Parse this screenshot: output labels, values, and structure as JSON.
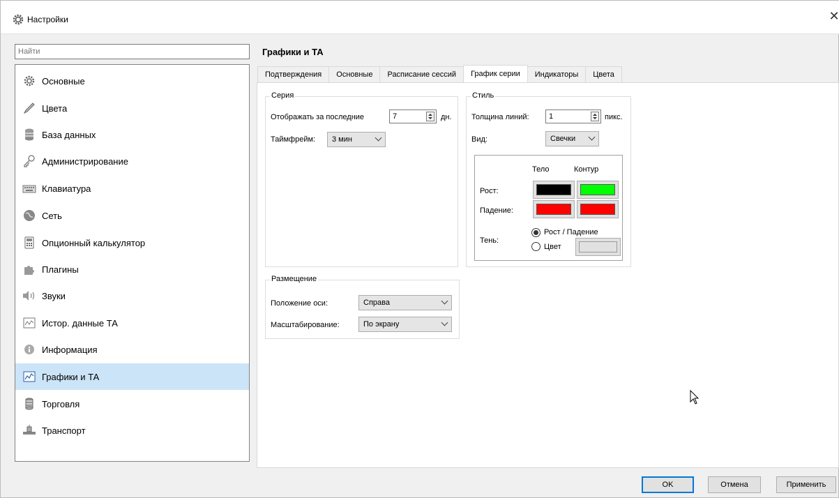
{
  "window": {
    "title": "Настройки",
    "title_icon": "gear-icon",
    "close_symbol": "✕"
  },
  "search": {
    "placeholder": "Найти"
  },
  "sidebar": {
    "items": [
      {
        "label": "Основные",
        "icon": "gear-icon"
      },
      {
        "label": "Цвета",
        "icon": "brush-icon"
      },
      {
        "label": "База данных",
        "icon": "database-icon"
      },
      {
        "label": "Администрирование",
        "icon": "key-icon"
      },
      {
        "label": "Клавиатура",
        "icon": "keyboard-icon"
      },
      {
        "label": "Сеть",
        "icon": "globe-icon"
      },
      {
        "label": "Опционный калькулятор",
        "icon": "calculator-icon"
      },
      {
        "label": "Плагины",
        "icon": "puzzle-icon"
      },
      {
        "label": "Звуки",
        "icon": "speaker-icon"
      },
      {
        "label": "Истор. данные ТА",
        "icon": "history-chart-icon"
      },
      {
        "label": "Информация",
        "icon": "info-icon"
      },
      {
        "label": "Графики и ТА",
        "icon": "chart-icon"
      },
      {
        "label": "Торговля",
        "icon": "coins-icon"
      },
      {
        "label": "Транспорт",
        "icon": "transport-icon"
      }
    ],
    "active_index": 11
  },
  "main": {
    "section_title": "Графики и ТА",
    "tabs": [
      "Подтверждения",
      "Основные",
      "Расписание сессий",
      "График серии",
      "Индикаторы",
      "Цвета"
    ],
    "active_tab": 3,
    "series_group": {
      "title": "Серия",
      "show_last_label": "Отображать за последние",
      "show_last_value": "7",
      "show_last_unit": "дн.",
      "timeframe_label": "Таймфрейм:",
      "timeframe_value": "3 мин"
    },
    "style_group": {
      "title": "Стиль",
      "line_width_label": "Толщина линий:",
      "line_width_value": "1",
      "line_width_unit": "пикс.",
      "view_label": "Вид:",
      "view_value": "Свечки",
      "body_header": "Тело",
      "outline_header": "Контур",
      "rise_label": "Рост:",
      "fall_label": "Падение:",
      "shadow_label": "Тень:",
      "shadow_option_1": "Рост / Падение",
      "shadow_option_2": "Цвет",
      "colors": {
        "rise_body": "#000000",
        "rise_outline": "#00ff00",
        "fall_body": "#ff0000",
        "fall_outline": "#ff0000",
        "shadow_color": "#e1e1e1"
      }
    },
    "placement_group": {
      "title": "Размещение",
      "axis_position_label": "Положение оси:",
      "axis_position_value": "Справа",
      "scaling_label": "Масштабирование:",
      "scaling_value": "По экрану"
    }
  },
  "footer": {
    "ok": "OK",
    "cancel": "Отмена",
    "apply": "Применить"
  },
  "accent_color": "#0078d7",
  "selection_color": "#cce4f7"
}
